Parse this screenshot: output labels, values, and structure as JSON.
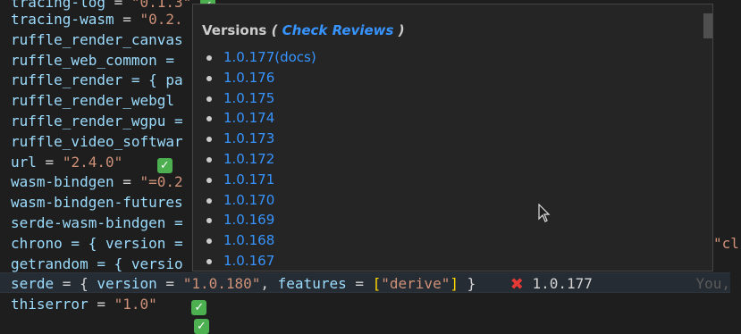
{
  "editor": {
    "lines": [
      {
        "key": "tracing-log",
        "rest": " = \"0.1.3\""
      },
      {
        "key": "tracing-wasm",
        "rest": " = \"0.2.",
        "str": "\"0.2."
      },
      {
        "key": "ruffle_render_canvas"
      },
      {
        "key": "ruffle_web_common = "
      },
      {
        "key": "ruffle_render = { pa"
      },
      {
        "key": "ruffle_render_webgl"
      },
      {
        "key": "ruffle_render_wgpu ="
      },
      {
        "key": "ruffle_video_softwar"
      },
      {
        "key": "url",
        "value": "\"2.4.0\""
      },
      {
        "key": "wasm-bindgen",
        "value": "\"=0.2"
      },
      {
        "key": "wasm-bindgen-futures"
      },
      {
        "key": "serde-wasm-bindgen ="
      },
      {
        "key": "chrono = { version =",
        "tail": "\"cl"
      },
      {
        "key": "getrandom = { versio"
      },
      {
        "key": "serde",
        "version": "\"1.0.180\"",
        "features": "\"derive\"",
        "status": "1.0.177",
        "ghost": "You,"
      },
      {
        "key": "thiserror",
        "value": "\"1.0\""
      }
    ]
  },
  "popup": {
    "title": "Versions",
    "link": "Check Reviews",
    "versions": [
      "1.0.177(docs)",
      "1.0.176",
      "1.0.175",
      "1.0.174",
      "1.0.173",
      "1.0.172",
      "1.0.171",
      "1.0.170",
      "1.0.169",
      "1.0.168",
      "1.0.167"
    ]
  },
  "icons": {
    "check": "check-mark-icon",
    "cross": "cross-mark-icon",
    "cursor": "mouse-pointer-icon"
  },
  "colors": {
    "background": "#1e1e1e",
    "popup_bg": "#252526",
    "link": "#3794ff",
    "key": "#9cdcfe",
    "string": "#ce9178"
  }
}
